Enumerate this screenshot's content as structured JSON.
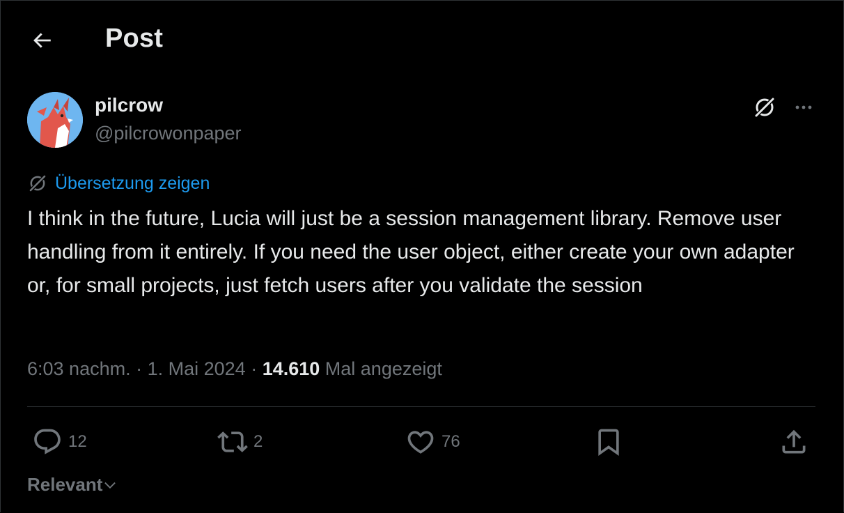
{
  "header": {
    "title": "Post",
    "back_icon": "arrow-left-icon"
  },
  "author": {
    "name": "pilcrow",
    "handle": "@pilcrowonpaper",
    "avatar": "fox-avatar"
  },
  "actions_top": {
    "grok_icon": "grok-icon",
    "more_icon": "more-dots-icon"
  },
  "translate": {
    "label": "Übersetzung zeigen",
    "icon": "grok-icon"
  },
  "tweet": {
    "text": "I think in the future, Lucia will just be a session management library. Remove user handling from it entirely. If you need the user object, either create your own adapter or, for small projects, just fetch users after you validate the session"
  },
  "meta": {
    "time": "6:03 nachm.",
    "sep1": " · ",
    "date": "1. Mai 2024",
    "sep2": " · ",
    "views": "14.610",
    "views_label": " Mal angezeigt"
  },
  "stats": {
    "replies": "12",
    "retweets": "2",
    "likes": "76"
  },
  "sort": {
    "label": "Relevant"
  },
  "colors": {
    "accent": "#1d9bf0",
    "text": "#e7e9ea",
    "muted": "#71767b",
    "border": "#2f3336",
    "background": "#000000"
  }
}
